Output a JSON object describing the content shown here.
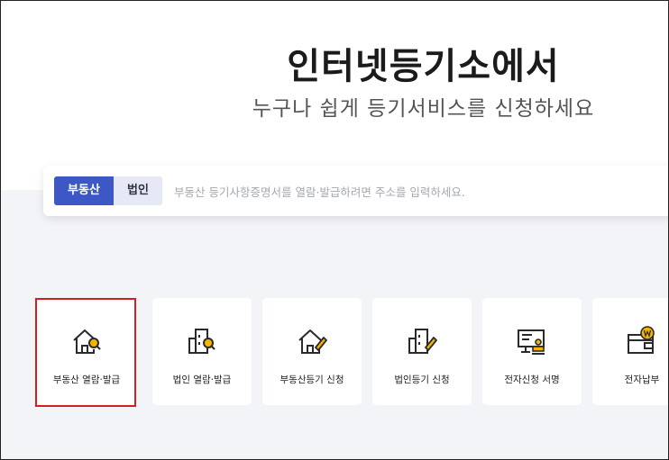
{
  "hero": {
    "title": "인터넷등기소에서",
    "subtitle": "누구나 쉽게 등기서비스를 신청하세요"
  },
  "search": {
    "tabs": [
      "부동산",
      "법인"
    ],
    "active_tab": "부동산",
    "placeholder": "부동산 등기사항증명서를 열람·발급하려면 주소를 입력하세요."
  },
  "services": [
    {
      "label": "부동산 열람·발급",
      "icon": "house-search-icon"
    },
    {
      "label": "법인 열람·발급",
      "icon": "building-search-icon"
    },
    {
      "label": "부동산등기 신청",
      "icon": "house-pen-icon"
    },
    {
      "label": "법인등기 신청",
      "icon": "building-pen-icon"
    },
    {
      "label": "전자신청 서명",
      "icon": "monitor-stamp-icon"
    },
    {
      "label": "전자납부",
      "icon": "wallet-won-icon"
    }
  ],
  "colors": {
    "primary": "#3d57c4",
    "accent_icon": "#f5b400",
    "highlight": "#d0201f"
  }
}
